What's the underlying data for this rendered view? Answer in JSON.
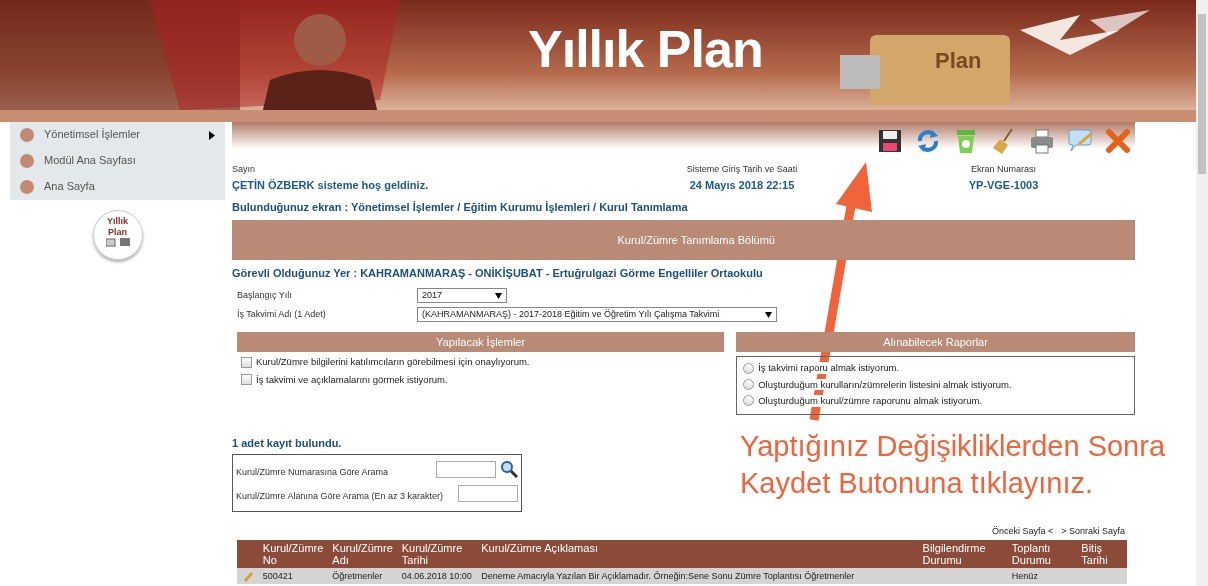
{
  "banner": {
    "title": "Yıllık Plan",
    "usb_label": "Plan"
  },
  "sidebar": {
    "items": [
      {
        "label": "Yönetimsel İşlemler",
        "submenu": true
      },
      {
        "label": "Modül Ana Sayfası",
        "submenu": false
      },
      {
        "label": "Ana Sayfa",
        "submenu": false
      }
    ],
    "logo_lines": [
      "Yıllık",
      "Plan"
    ]
  },
  "toolbar": {
    "buttons": [
      {
        "kind": "save"
      },
      {
        "kind": "refresh"
      },
      {
        "kind": "recycle"
      },
      {
        "kind": "broom"
      },
      {
        "kind": "print"
      },
      {
        "kind": "comment"
      },
      {
        "kind": "close"
      }
    ]
  },
  "info": [
    {
      "label": "Sayın",
      "value": "ÇETİN ÖZBERK sisteme hoş geldiniz."
    },
    {
      "label": "Sisteme Giriş Tarih ve Saati",
      "value": "24 Mayıs 2018 22:15"
    },
    {
      "label": "Ekran Numarası",
      "value": "YP-VGE-1003"
    }
  ],
  "breadcrumb": "Bulunduğunuz ekran : Yönetimsel İşlemler / Eğitim Kurumu İşlemleri / Kurul Tanımlama",
  "section_title": "Kurul/Zümre Tanımlama Bölümü",
  "location": "Görevli Olduğunuz Yer : KAHRAMANMARAŞ - ONİKİŞUBAT - Ertuğrulgazi Görme Engelliler Ortaokulu",
  "selects": [
    {
      "label": "Başlangıç Yılı",
      "value": "2017"
    },
    {
      "label": "İş Takvimi Adı (1 Adet)",
      "value": "(KAHRAMANMARAŞ) - 2017-2018 Eğitim ve Öğretim Yılı Çalışma Takvimi"
    }
  ],
  "actions": {
    "title": "Yapılacak İşlemler",
    "items": [
      {
        "label": "Kurul/Zümre bilgilerini katılımcıların görebilmesi için onaylıyorum.",
        "checked": false
      },
      {
        "label": "İş takvimi ve açıklamalarını görmek istiyorum.",
        "checked": false
      }
    ]
  },
  "reports": {
    "title": "Alınabilecek Raporlar",
    "items": [
      {
        "label": "İş takvimi raporu almak istiyorum.",
        "selected": false
      },
      {
        "label": "Oluşturduğum kurulların/zümrelerin listesini almak istiyorum.",
        "selected": false
      },
      {
        "label": "Oluşturduğum kurul/zümre raporunu almak istiyorum.",
        "selected": false
      }
    ]
  },
  "record_count": "1 adet kayıt bulundu.",
  "search": {
    "fields": [
      {
        "label": "Kurul/Zümre Numarasına Göre Arama"
      },
      {
        "label": "Kurul/Zümre Alanına Göre Arama (En az 3 karakter)"
      }
    ]
  },
  "pager": {
    "prev": "Önceki Sayfa <",
    "next": "> Sonraki Sayfa"
  },
  "table": {
    "columns": [
      "Kurul/Zümre No",
      "Kurul/Zümre Adı",
      "Kurul/Zümre Tarihi",
      "Kurul/Zümre Açıklaması",
      "Bilgilendirme Durumu",
      "Toplantı Durumu",
      "Bitiş Tarihi"
    ],
    "rows": [
      {
        "no": "500421",
        "name": "Öğretmenler",
        "date": "04.06.2018 10:00",
        "description": "Deneme Amacıyla Yazılan Bir Açıklamadır. Örneğin:Sene Sonu Zümre Toplantısı Öğretmenler",
        "meeting": "Henüz"
      }
    ]
  },
  "annotation": {
    "lines": [
      "Yaptığınız Değişikliklerden Sonra",
      "Kaydet Butonuna tıklayınız."
    ]
  }
}
